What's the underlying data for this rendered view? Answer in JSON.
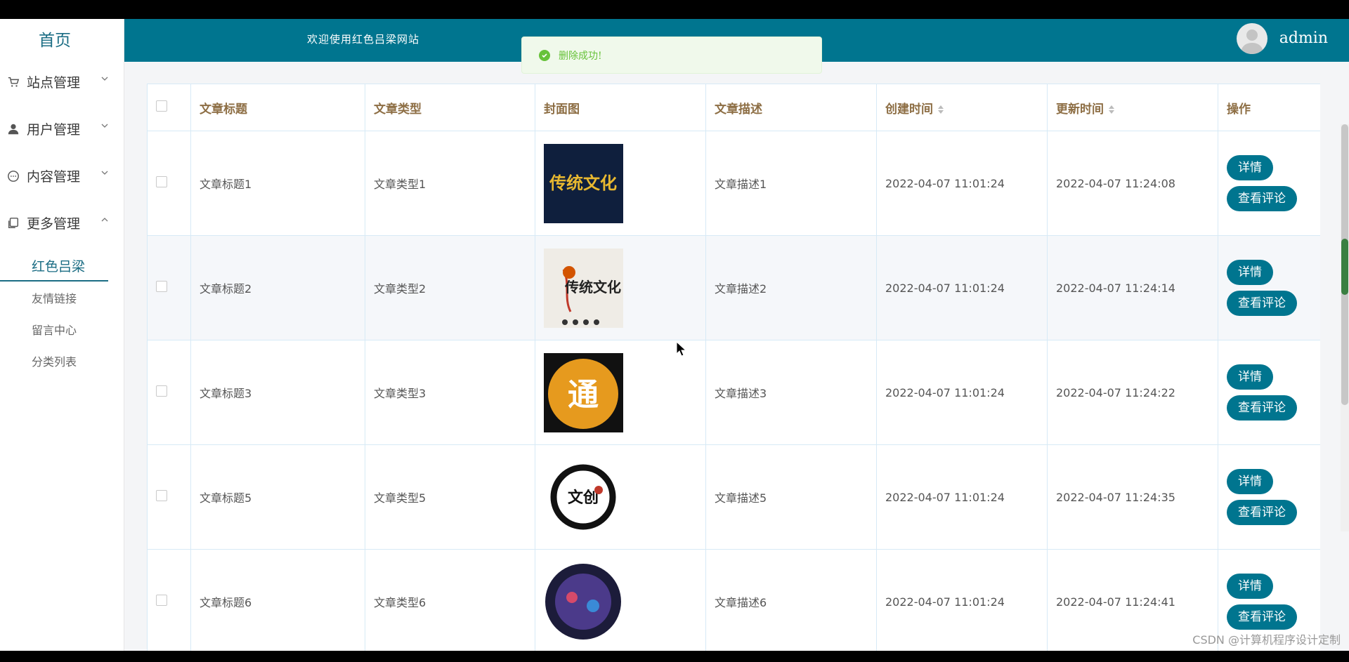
{
  "sidebar": {
    "home": "首页",
    "menus": [
      {
        "label": "站点管理",
        "icon": "cart-icon"
      },
      {
        "label": "用户管理",
        "icon": "user-icon"
      },
      {
        "label": "内容管理",
        "icon": "chat-icon"
      },
      {
        "label": "更多管理",
        "icon": "copy-icon"
      }
    ],
    "active_sub": "红色吕梁",
    "subs": [
      "友情链接",
      "留言中心",
      "分类列表"
    ]
  },
  "header": {
    "welcome": "欢迎使用红色吕梁网站",
    "username": "admin"
  },
  "toast": {
    "message": "删除成功!"
  },
  "table": {
    "columns": [
      "文章标题",
      "文章类型",
      "封面图",
      "文章描述",
      "创建时间",
      "更新时间",
      "操作"
    ],
    "detail_label": "详情",
    "comment_label": "查看评论",
    "rows": [
      {
        "title": "文章标题1",
        "type": "文章类型1",
        "desc": "文章描述1",
        "created": "2022-04-07 11:01:24",
        "updated": "2022-04-07 11:24:08",
        "cover_text": "传统文化"
      },
      {
        "title": "文章标题2",
        "type": "文章类型2",
        "desc": "文章描述2",
        "created": "2022-04-07 11:01:24",
        "updated": "2022-04-07 11:24:14",
        "cover_text": "传统文化"
      },
      {
        "title": "文章标题3",
        "type": "文章类型3",
        "desc": "文章描述3",
        "created": "2022-04-07 11:01:24",
        "updated": "2022-04-07 11:24:22",
        "cover_text": "通"
      },
      {
        "title": "文章标题5",
        "type": "文章类型5",
        "desc": "文章描述5",
        "created": "2022-04-07 11:01:24",
        "updated": "2022-04-07 11:24:35",
        "cover_text": "文创"
      },
      {
        "title": "文章标题6",
        "type": "文章类型6",
        "desc": "文章描述6",
        "created": "2022-04-07 11:01:24",
        "updated": "2022-04-07 11:24:41",
        "cover_text": ""
      }
    ]
  },
  "watermark": "CSDN @计算机程序设计定制",
  "colors": {
    "primary": "#00758f",
    "header_text": "#8d6e44",
    "success": "#67c23a"
  }
}
